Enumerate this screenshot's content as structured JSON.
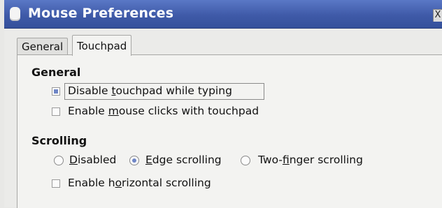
{
  "window": {
    "title": "Mouse Preferences",
    "close_glyph": "X"
  },
  "tabs": [
    {
      "label": "General",
      "active": false
    },
    {
      "label": "Touchpad",
      "active": true
    }
  ],
  "general_section": {
    "title": "General",
    "disable_while_typing": {
      "pre": "Disable ",
      "mnemonic": "t",
      "post": "ouchpad while typing",
      "checked": true
    },
    "enable_clicks": {
      "pre": "Enable ",
      "mnemonic": "m",
      "post": "ouse clicks with touchpad",
      "checked": false
    }
  },
  "scrolling_section": {
    "title": "Scrolling",
    "disabled": {
      "pre": "",
      "mnemonic": "D",
      "post": "isabled",
      "selected": false
    },
    "edge": {
      "pre": "",
      "mnemonic": "E",
      "post": "dge scrolling",
      "selected": true
    },
    "two_finger": {
      "pre": "Two-",
      "mnemonic": "f",
      "post": "inger scrolling",
      "selected": false
    },
    "horizontal": {
      "pre": "Enable h",
      "mnemonic": "o",
      "post": "rizontal scrolling",
      "checked": false
    }
  },
  "colors": {
    "titlebar": "#3f5aa8",
    "check_accent": "#6f86c6"
  }
}
